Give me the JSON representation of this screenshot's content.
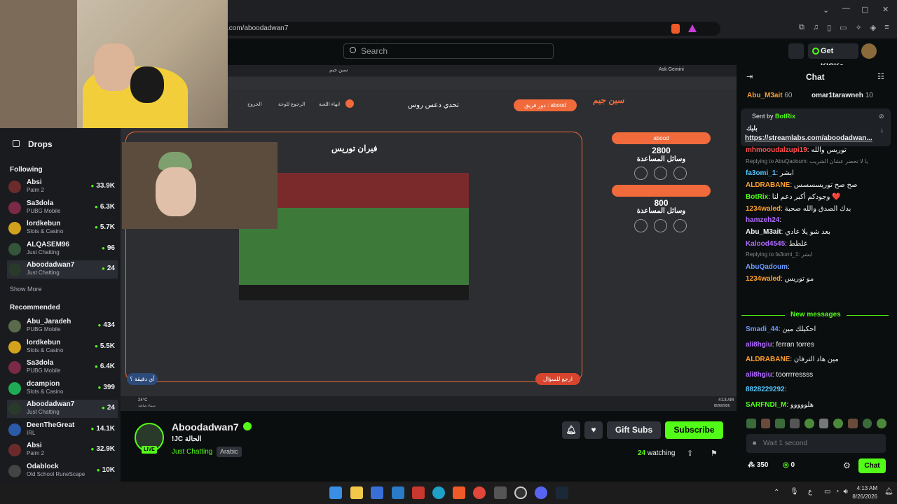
{
  "browser": {
    "url": ".com/aboodadwan7",
    "controls": [
      "⌄",
      "—",
      "▢",
      "✕"
    ]
  },
  "header": {
    "search_placeholder": "Search",
    "get_kicks": "Get KICKs"
  },
  "sidebar": {
    "drops": "Drops",
    "following_title": "Following",
    "following": [
      {
        "name": "Absi",
        "category": "Palm 2",
        "viewers": "33.9K",
        "color": "#6b2b2b"
      },
      {
        "name": "Sa3dola",
        "category": "PUBG Mobile",
        "viewers": "6.3K",
        "color": "#7a2a44"
      },
      {
        "name": "lordkebun",
        "category": "Slots & Casino",
        "viewers": "5.7K",
        "color": "#d2a21c"
      },
      {
        "name": "ALQASEM96",
        "category": "Just Chatting",
        "viewers": "96",
        "color": "#33553a"
      },
      {
        "name": "Aboodadwan7",
        "category": "Just Chatting",
        "viewers": "24",
        "color": "#2a3a2a"
      }
    ],
    "show_more": "Show More",
    "recommended_title": "Recommended",
    "recommended": [
      {
        "name": "Abu_Jaradeh",
        "category": "PUBG Mobile",
        "viewers": "434",
        "color": "#5a6a4a"
      },
      {
        "name": "lordkebun",
        "category": "Slots & Casino",
        "viewers": "5.5K",
        "color": "#d2a21c"
      },
      {
        "name": "Sa3dola",
        "category": "PUBG Mobile",
        "viewers": "6.4K",
        "color": "#7a2a44"
      },
      {
        "name": "dcampion",
        "category": "Slots & Casino",
        "viewers": "399",
        "color": "#1faa55"
      },
      {
        "name": "Aboodadwan7",
        "category": "Just Chatting",
        "viewers": "24",
        "color": "#2a3a2a"
      },
      {
        "name": "DeenTheGreat",
        "category": "IRL",
        "viewers": "14.1K",
        "color": "#2a5aa8"
      },
      {
        "name": "Absi",
        "category": "Palm 2",
        "viewers": "32.9K",
        "color": "#6b2b2b"
      },
      {
        "name": "Odablock",
        "category": "Old School RuneScape",
        "viewers": "10K",
        "color": "#444"
      }
    ]
  },
  "stream_screen": {
    "tab": "سين جيم",
    "ask_gemini": "Ask Gemini",
    "title": "تحدي دعس روس",
    "team_label": "دور فريق : abood",
    "end_game": "انهاء اللعبة",
    "back_board": "الرجوع للوحة",
    "exit": "الخروج",
    "logo": "سين جيم",
    "question": "فيران توريس",
    "team1_name": "abood",
    "team1_score": "2800",
    "team1_aids": "وسائل المساعدة",
    "team2_score": "800",
    "team2_aids": "وسائل المساعدة",
    "back_question": "ارجع للسؤال",
    "any_team": "أي دقيقة ؟",
    "weather": "24°C",
    "weather_sub": "سماء صافية",
    "clock_time": "4:13 AM",
    "clock_date": "8/26/2026"
  },
  "stream_info": {
    "channel": "Aboodadwan7",
    "live": "LIVE",
    "title": "!JC الحالة",
    "category": "Just Chatting",
    "tag": "Arabic",
    "gift": "Gift Subs",
    "subscribe": "Subscribe",
    "viewers": "24",
    "watching": "watching"
  },
  "chat": {
    "title": "Chat",
    "leaderboard": [
      {
        "name": "Abu_M3ait",
        "score": "60"
      },
      {
        "name": "omar1tarawneh",
        "score": "10"
      }
    ],
    "pinned": {
      "sent_by": "Sent by",
      "user": "BotRix",
      "line1": "بليك",
      "link": "https://streamlabs.com/aboodadwan..."
    },
    "messages": [
      {
        "user": "mhmooudalzupi19",
        "text": "توريس والله",
        "color": "#ff4d4d"
      },
      {
        "user": "",
        "text": "Replying to AbuQadoum: يا لا تحضر عشان الشريب",
        "color": "#888"
      },
      {
        "user": "fa3omi_1",
        "text": "ابشر",
        "color": "#53c6ff"
      },
      {
        "user": "ALDRABANE",
        "text": "صح صح توريسسسس",
        "color": "#ff9f2e"
      },
      {
        "user": "BotRix",
        "text": "وجودكم أكبر دعم لنا ❤️",
        "color": "#53fc18"
      },
      {
        "user": "1234waled",
        "text": "بدك الصدق والله صحبة",
        "color": "#ff9f2e"
      },
      {
        "user": "hamzeh24",
        "text": "",
        "color": "#b069ff"
      },
      {
        "user": "Abu_M3ait",
        "text": "بعد شو يلا عادي",
        "color": "#efeff1"
      },
      {
        "user": "Kalood4545",
        "text": "غلطط",
        "color": "#b069ff"
      },
      {
        "user": "",
        "text": "Replying to fa3omi_1: ابشر",
        "color": "#888"
      },
      {
        "user": "AbuQadoum",
        "text": "",
        "color": "#6a9bff"
      },
      {
        "user": "1234waled",
        "text": "مو توريس",
        "color": "#ff9f2e"
      }
    ],
    "new_messages": "New messages",
    "messages2": [
      {
        "user": "Smadi_44",
        "text": "احكيلك مين",
        "color": "#6a9bff"
      },
      {
        "user": "ali8hgiu",
        "text": "ferran torres",
        "color": "#b069ff"
      },
      {
        "user": "ALDRABANE",
        "text": "مين هاد الترفان",
        "color": "#ff9f2e"
      },
      {
        "user": "ali8hgiu",
        "text": "toorrrressss",
        "color": "#b069ff"
      },
      {
        "user": "8828229292",
        "text": "",
        "color": "#53c6ff"
      },
      {
        "user": "SARFNDI_M",
        "text": "هلووووو",
        "color": "#53fc18"
      }
    ],
    "input_placeholder": "Wait 1 second",
    "points": "350",
    "kicks": "0",
    "chat_button": "Chat"
  },
  "taskbar": {
    "time": "4:13 AM",
    "date": "8/26/2026",
    "lang": "ع"
  }
}
